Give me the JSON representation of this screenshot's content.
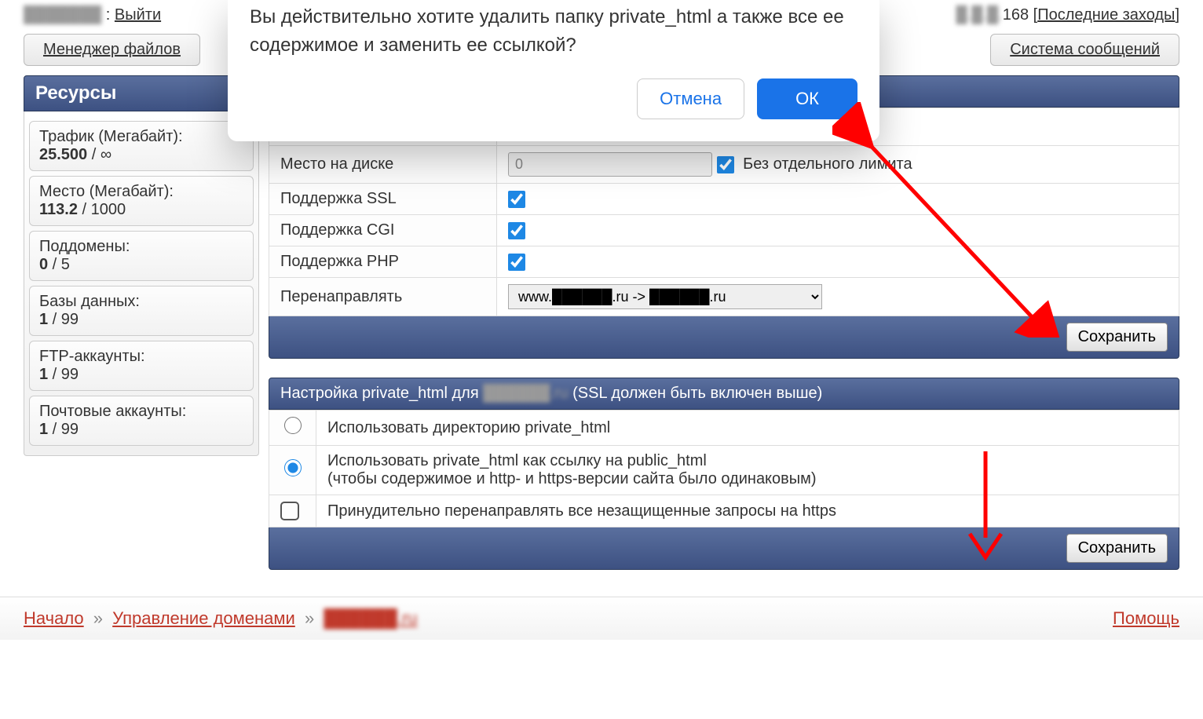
{
  "top": {
    "logout": "Выйти",
    "ip_suffix": "168",
    "last_logins": "Последние заходы"
  },
  "toolbar": {
    "file_manager": "Менеджер файлов",
    "messages": "Система сообщений"
  },
  "resources": {
    "title": "Ресурсы",
    "items": [
      {
        "label": "Трафик (Мегабайт):",
        "value": "25.500",
        "limit": " / ∞"
      },
      {
        "label": "Место (Мегабайт):",
        "value": "113.2",
        "limit": " / 1000"
      },
      {
        "label": "Поддомены:",
        "value": "0",
        "limit": " / 5"
      },
      {
        "label": "Базы данных:",
        "value": "1",
        "limit": " / 99"
      },
      {
        "label": "FTP-аккаунты:",
        "value": "1",
        "limit": " / 99"
      },
      {
        "label": "Почтовые аккаунты:",
        "value": "1",
        "limit": " / 99"
      }
    ]
  },
  "settings": {
    "limit_suffix": "имита",
    "disk_label": "Место на диске",
    "disk_value": "0",
    "disk_no_limit": "Без отдельного лимита",
    "ssl_label": "Поддержка SSL",
    "cgi_label": "Поддержка CGI",
    "php_label": "Поддержка PHP",
    "redirect_label": "Перенаправлять",
    "redirect_option": "www.██████.ru -> ██████.ru",
    "save": "Сохранить"
  },
  "private_html": {
    "title_prefix": "Настройка private_html для ",
    "title_domain": "██████.ru",
    "title_suffix": " (SSL должен быть включен выше)",
    "opt1": "Использовать директорию private_html",
    "opt2_line1": "Использовать private_html как ссылку на public_html",
    "opt2_line2": "(чтобы содержимое и http- и https-версии сайта было одинаковым)",
    "force_https": "Принудительно перенаправлять все незащищенные запросы на https",
    "save": "Сохранить"
  },
  "modal": {
    "text": "Вы действительно хотите удалить папку private_html а также все ее содержимое и заменить ее ссылкой?",
    "cancel": "Отмена",
    "ok": "ОК"
  },
  "breadcrumb": {
    "home": "Начало",
    "domains": "Управление доменами",
    "current": "██████.ru",
    "help": "Помощь"
  }
}
